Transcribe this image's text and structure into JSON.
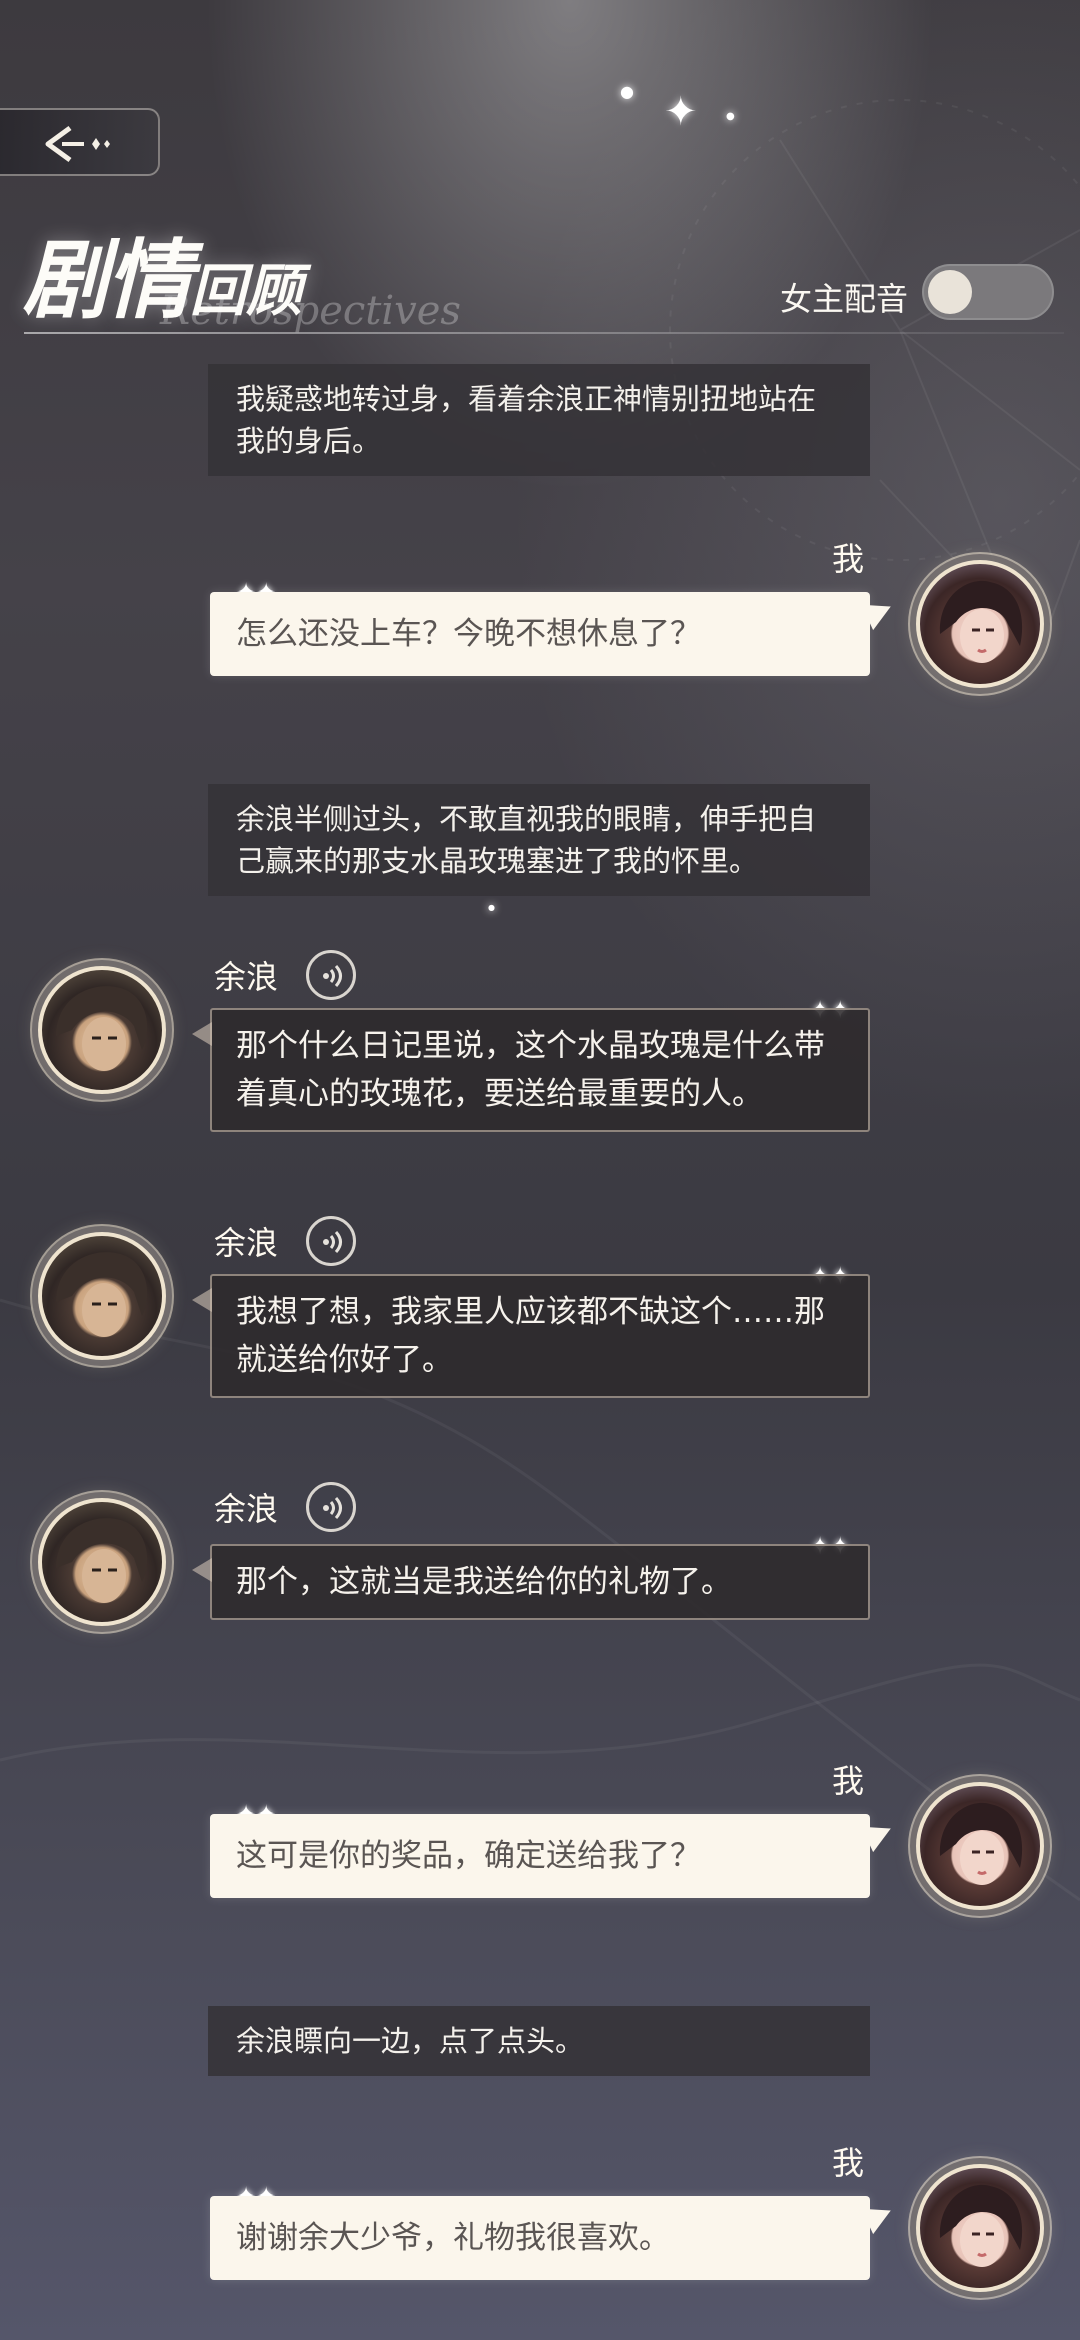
{
  "header": {
    "title_main": "剧情",
    "title_small": "回顾",
    "title_sub": "Retrospectives",
    "voice_toggle_label": "女主配音",
    "voice_toggle_on": false
  },
  "messages": {
    "m0": {
      "type": "narration",
      "text": "我疑惑地转过身，看着余浪正神情别扭地站在我的身后。"
    },
    "m1": {
      "type": "player",
      "name": "我",
      "text": "怎么还没上车？今晚不想休息了？"
    },
    "m2": {
      "type": "narration",
      "text": "余浪半侧过头，不敢直视我的眼睛，伸手把自己赢来的那支水晶玫瑰塞进了我的怀里。"
    },
    "m3": {
      "type": "npc",
      "name": "余浪",
      "text": "那个什么日记里说，这个水晶玫瑰是什么带着真心的玫瑰花，要送给最重要的人。"
    },
    "m4": {
      "type": "npc",
      "name": "余浪",
      "text": "我想了想，我家里人应该都不缺这个……那就送给你好了。"
    },
    "m5": {
      "type": "npc",
      "name": "余浪",
      "text": "那个，这就当是我送给你的礼物了。"
    },
    "m6": {
      "type": "player",
      "name": "我",
      "text": "这可是你的奖品，确定送给我了？"
    },
    "m7": {
      "type": "narration",
      "text": "余浪瞟向一边，点了点头。"
    },
    "m8": {
      "type": "player",
      "name": "我",
      "text": "谢谢余大少爷，礼物我很喜欢。"
    }
  },
  "icons": {
    "back": "back-arrow-icon",
    "voice": "speaker-icon",
    "sparkle": "sparkle-icon"
  },
  "colors": {
    "player_bubble": "#fbf6ec",
    "npc_bubble": "#2e2a2c",
    "narration_bg": "#343237"
  }
}
